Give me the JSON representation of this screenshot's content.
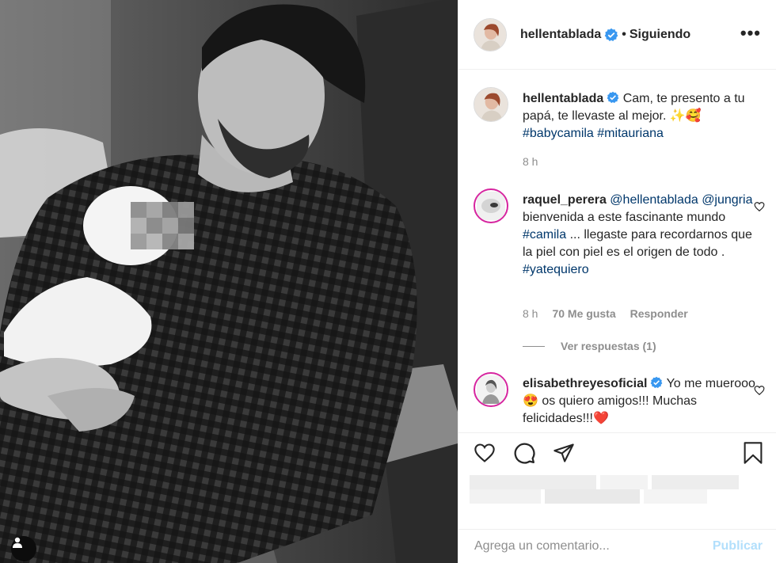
{
  "post": {
    "username": "hellentablada",
    "follow_separator": "•",
    "follow_status": "Siguiendo",
    "more_label": "•••"
  },
  "caption": {
    "username": "hellentablada",
    "text_1": "Cam, te presento a tu papá, te llevaste al mejor. ✨🥰",
    "hashtag_1": "#babycamila",
    "hashtag_2": "#mitauriana",
    "time": "8 h"
  },
  "comments": [
    {
      "username": "raquel_perera",
      "mention_1": "@hellentablada",
      "mention_2": "@jungria",
      "text_1": "bienvenida a este fascinante mundo",
      "hashtag_1": "#camila",
      "text_2": "... llegaste para recordarnos que la piel con piel es el origen de todo .",
      "hashtag_2": "#yatequiero",
      "time": "8 h",
      "likes": "70 Me gusta",
      "reply": "Responder",
      "view_replies": "Ver respuestas (1)"
    },
    {
      "username": "elisabethreyesoficial",
      "text": "Yo me muerooo😍 os quiero amigos!!! Muchas felicidades!!!❤️"
    }
  ],
  "add_comment": {
    "placeholder": "Agrega un comentario...",
    "publish": "Publicar"
  },
  "icons": [
    "verified-badge-icon",
    "heart-icon",
    "comment-icon",
    "share-icon",
    "bookmark-icon",
    "user-tag-icon",
    "more-icon"
  ],
  "colors": {
    "verified": "#3897f0",
    "link": "#00376b",
    "secondary_text": "#8e8e8e",
    "publish_disabled": "#b2dffc",
    "story_ring": "#d6249f"
  }
}
